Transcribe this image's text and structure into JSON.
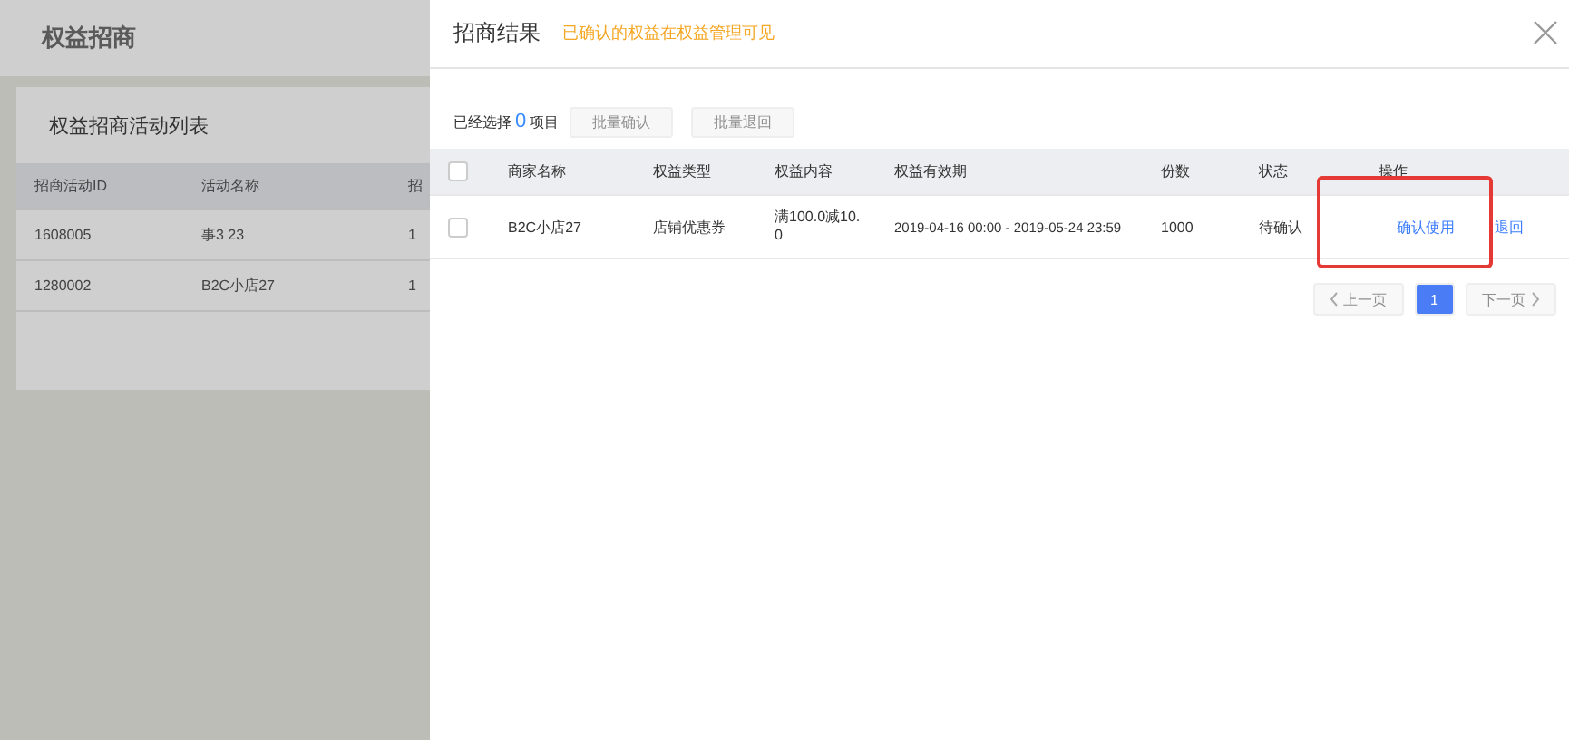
{
  "page": {
    "title": "权益招商",
    "list_title": "权益招商活动列表",
    "columns": [
      "招商活动ID",
      "活动名称",
      "招"
    ],
    "rows": [
      {
        "id": "1608005",
        "name": "事3 23",
        "column_3": "1"
      },
      {
        "id": "1280002",
        "name": "B2C小店27",
        "column_3": "1"
      }
    ]
  },
  "drawer": {
    "title": "招商结果",
    "notice": "已确认的权益在权益管理可见",
    "selection": {
      "prefix": "已经选择",
      "count": "0",
      "suffix": "项目"
    },
    "batch_buttons": [
      {
        "label": "批量确认",
        "disabled": true
      },
      {
        "label": "批量退回",
        "disabled": true
      }
    ],
    "table": {
      "select_all_checked": false,
      "columns": [
        "商家名称",
        "权益类型",
        "权益内容",
        "权益有效期",
        "份数",
        "状态",
        "操作"
      ],
      "rows": [
        {
          "checked": false,
          "merchant": "B2C小店27",
          "type": "店铺优惠券",
          "content": "满100.0减10.0",
          "validity": "2019-04-16 00:00 - 2019-05-24 23:59",
          "quantity": "1000",
          "status": "待确认",
          "actions": [
            "确认使用",
            "退回"
          ]
        }
      ]
    },
    "pagination": {
      "prev": "上一页",
      "pages": [
        {
          "label": "1",
          "selected": true
        }
      ],
      "next": "下一页",
      "prev_disabled": true,
      "next_disabled": true
    }
  }
}
